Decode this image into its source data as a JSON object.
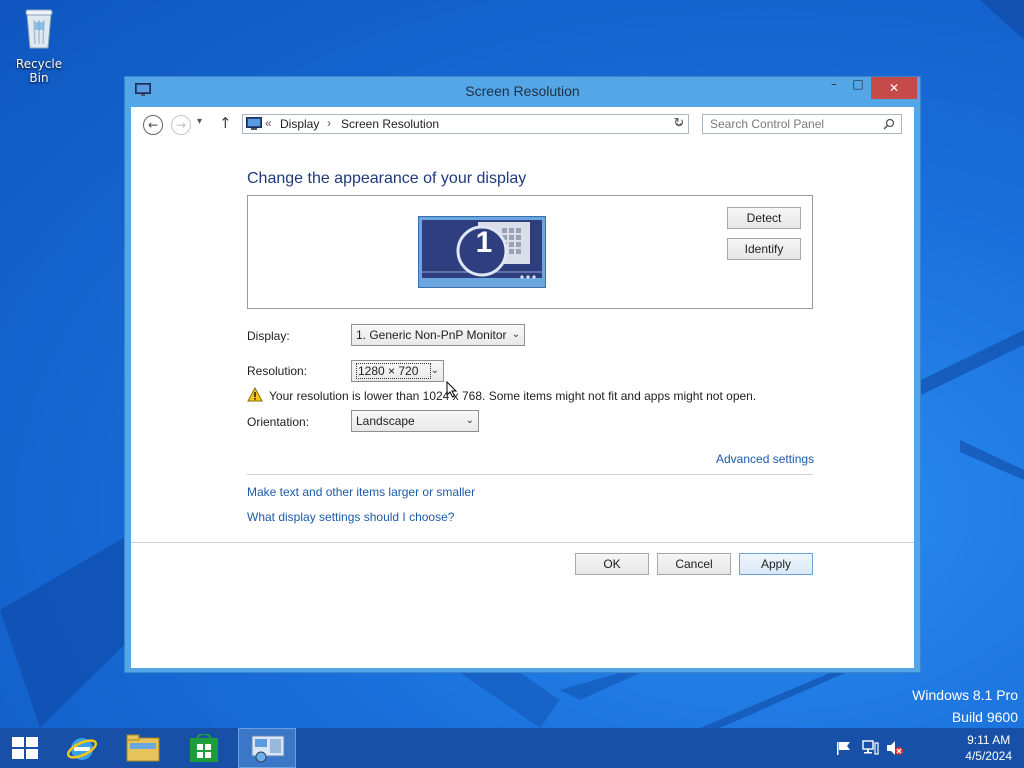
{
  "desktop": {
    "recycle_bin_label": "Recycle Bin",
    "watermark_line1": "Windows 8.1 Pro",
    "watermark_line2": "Build 9600"
  },
  "window": {
    "title": "Screen Resolution",
    "controls": {
      "minimize": "–",
      "maximize": "□",
      "close": "✕"
    }
  },
  "nav": {
    "back": "←",
    "forward": "→",
    "recent": "▾",
    "up": "↑",
    "breadcrumb_prefix": "«",
    "breadcrumb": [
      "Display",
      "Screen Resolution"
    ],
    "breadcrumb_sep": "›",
    "addr_dropdown": "⌄",
    "refresh": "↻",
    "search_placeholder": "Search Control Panel"
  },
  "content": {
    "heading": "Change the appearance of your display",
    "monitor_number": "1",
    "detect_label": "Detect",
    "identify_label": "Identify",
    "display_label": "Display:",
    "display_value": "1. Generic Non-PnP Monitor",
    "resolution_label": "Resolution:",
    "resolution_value": "1280 × 720",
    "warning_text": "Your resolution is lower than 1024 x 768. Some items might not fit and apps might not open.",
    "orientation_label": "Orientation:",
    "orientation_value": "Landscape",
    "advanced_link": "Advanced settings",
    "link_text_size": "Make text and other items larger or smaller",
    "link_help": "What display settings should I choose?"
  },
  "buttons": {
    "ok": "OK",
    "cancel": "Cancel",
    "apply": "Apply"
  },
  "taskbar": {
    "time": "9:11 AM",
    "date": "4/5/2024"
  },
  "colors": {
    "accent": "#55a6e6",
    "close_red": "#c74a4a",
    "link": "#1c5aa8",
    "taskbar": "#1850a8"
  }
}
